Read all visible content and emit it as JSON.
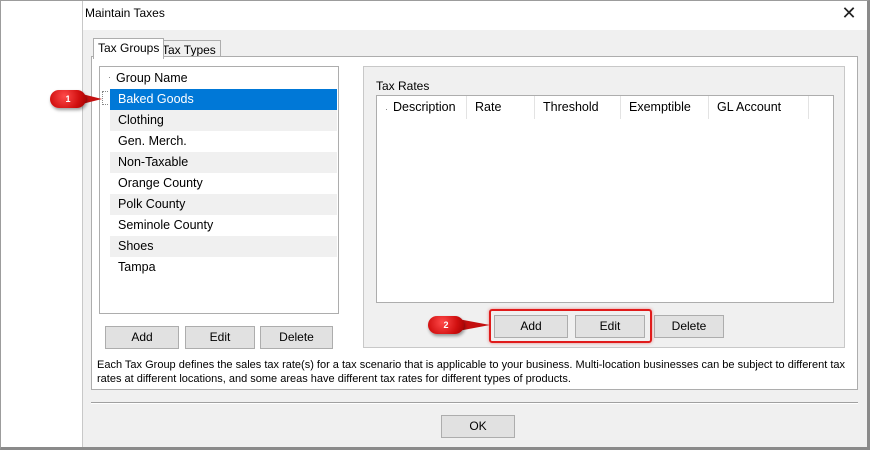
{
  "window": {
    "title": "Maintain Taxes",
    "close_glyph": "✕"
  },
  "tabs": [
    {
      "label": "Tax Groups",
      "active": true
    },
    {
      "label": "Tax Types",
      "active": false
    }
  ],
  "tax_groups": {
    "header": "Group Name",
    "items": [
      {
        "label": "Baked Goods",
        "selected": true
      },
      {
        "label": "Clothing",
        "selected": false
      },
      {
        "label": "Gen. Merch.",
        "selected": false
      },
      {
        "label": "Non-Taxable",
        "selected": false
      },
      {
        "label": "Orange County",
        "selected": false
      },
      {
        "label": "Polk County",
        "selected": false
      },
      {
        "label": "Seminole County",
        "selected": false
      },
      {
        "label": "Shoes",
        "selected": false
      },
      {
        "label": "Tampa",
        "selected": false
      }
    ],
    "buttons": {
      "add": "Add",
      "edit": "Edit",
      "delete": "Delete"
    }
  },
  "tax_rates": {
    "label": "Tax Rates",
    "columns": [
      "Description",
      "Rate",
      "Threshold",
      "Exemptible",
      "GL Account"
    ],
    "buttons": {
      "add": "Add",
      "edit": "Edit",
      "delete": "Delete"
    }
  },
  "info_text": "Each Tax Group defines the sales tax rate(s) for a tax scenario that is applicable to your business. Multi-location businesses can be subject to different tax rates at different locations, and some areas have different tax rates for different types of products.",
  "ok_button": "OK",
  "callouts": [
    {
      "label": "1"
    },
    {
      "label": "2"
    }
  ],
  "colors": {
    "selection": "#0078d7",
    "callout": "#d11010",
    "highlight": "#e01b1b",
    "dialog_bg": "#f0f0f0"
  }
}
